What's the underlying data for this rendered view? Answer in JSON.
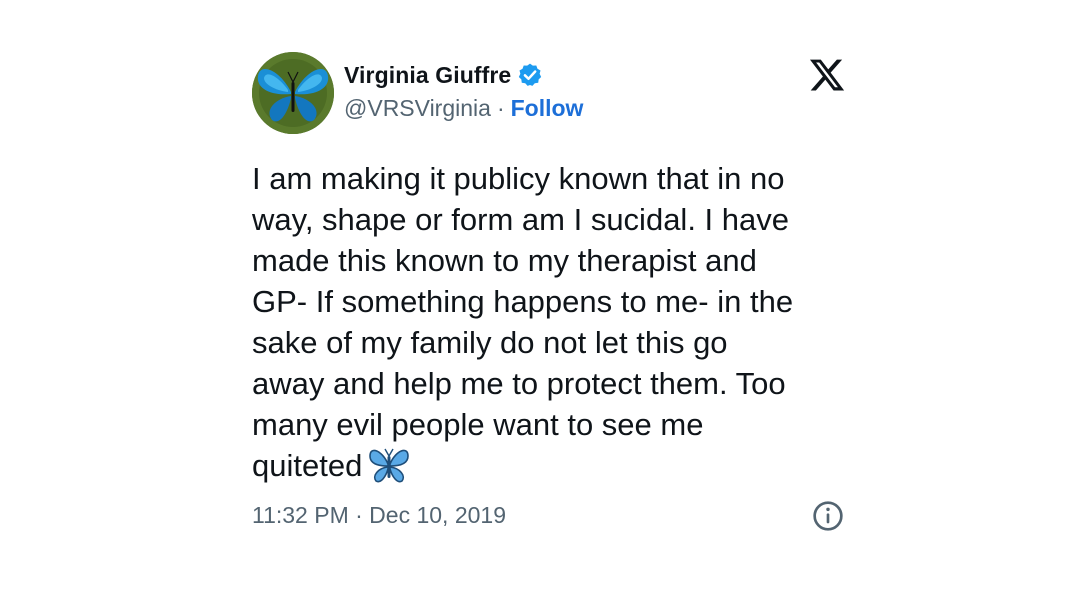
{
  "author": {
    "display_name": "Virginia Giuffre",
    "handle": "@VRSVirginia",
    "separator": "·",
    "follow_label": "Follow",
    "verified_icon": "verified-badge-icon",
    "avatar_icon": "blue-butterfly-avatar"
  },
  "brand": {
    "logo_icon": "x-logo-icon"
  },
  "tweet": {
    "text": "I am making it publicy known that in no\nway, shape or form am I sucidal. I have\nmade this known to my therapist and\nGP- If something happens to me- in the\nsake of my family do not let this go\naway and help me to protect them. Too\nmany evil people want to see me\nquiteted",
    "emoji": "butterfly-emoji",
    "timestamp": "11:32 PM · Dec 10, 2019"
  },
  "colors": {
    "text": "#0f1419",
    "secondary": "#536471",
    "follow": "#1d6fd8",
    "verified": "#1d9bf0"
  },
  "icons": {
    "info": "info-icon"
  }
}
